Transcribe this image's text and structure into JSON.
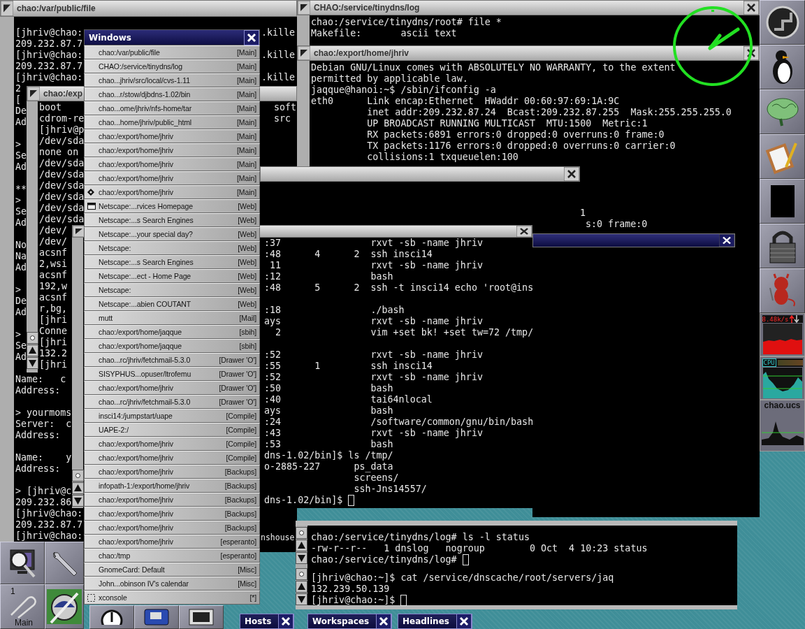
{
  "windows": [
    {
      "title": "chao:/var/public/file",
      "focused": false,
      "text_areas": [
        {
          "text": "[jhriv@chao:\n209.232.87.7\n[jhriv@chao:\n209.232.87.7\n[jhriv@chao:",
          "cursor": false
        },
        {
          "text": "2\n[\nDe\nAd\n\n>\nSe\nAd\n\n**\n>\nSe\nAd\n\nNo\nNa\nAd\n\n>\nDe\nAd\n\n>\nSe\nAd",
          "cursor": false
        },
        {
          "text": "Name:   c\nAddress:\n\n> yourmoms\nServer:  c\nAddress:\n\nName:    y\nAddress:\n\n> [jhriv@c\n209.232.86",
          "cursor": false
        },
        {
          "text": "[jhriv@chao:\n209.232.87.7\n[jhriv@chao:",
          "cursor": false
        },
        {
          "text": ".kille\n\n.kille\n\n.kille",
          "cursor": false
        }
      ]
    },
    {
      "title": "chao:/exp",
      "focused": false,
      "text_areas": [
        {
          "text": "boot\ncdrom-re\n[jhriv@p\n/dev/sda\nnone on\n/dev/sda\n/dev/sda\n/dev/sda\n/dev/sda\n/dev/sda\n/dev/sda",
          "cursor": false
        },
        {
          "text": "/dev/\n/dev/\nacsnf\n2,wsi\nacsnf\n192,w\nacsnf\nr,bg,\n[jhri\nConne\n[jhri\n132.2\n[jhri",
          "cursor": false
        },
        {
          "text": "soft\nsrc",
          "cursor": false
        }
      ]
    },
    {
      "title": "CHAO:/service/tinydns/log",
      "focused": false,
      "text_areas": [
        {
          "text": "chao:/service/tinydns/root# file *\nMakefile:       ascii text",
          "cursor": false
        }
      ]
    },
    {
      "title": "chao:/export/home/jhriv",
      "focused": false,
      "text_areas": [
        {
          "text": "Debian GNU/Linux comes with ABSOLUTELY NO WARRANTY, to the extent\npermitted by applicable law.\njaqque@hanoi:~$ /sbin/ifconfig -a\neth0      Link encap:Ethernet  HWaddr 00:60:97:69:1A:9C\n          inet addr:209.232.87.24  Bcast:209.232.87.255  Mask:255.255.255.0\n          UP BROADCAST RUNNING MULTICAST  MTU:1500  Metric:1\n          RX packets:6891 errors:0 dropped:0 overruns:0 frame:0\n          TX packets:1176 errors:0 dropped:0 overruns:0 carrier:0\n          collisions:1 txqueuelen:100",
          "cursor": false
        },
        {
          "text": "1\n s:0 frame:0",
          "cursor": false
        }
      ]
    },
    {
      "focused": false
    },
    {
      "focused": false,
      "text_areas": [
        {
          "text": ":37                rxvt -sb -name jhriv\n:48      4      2  ssh insci14\n 11                rxvt -sb -name jhriv\n:12                bash\n:48      5      2  ssh -t insci14 echo 'root@ins\n\n:18                ./bash\nays                rxvt -sb -name jhriv\n  2                vim +set bk! +set tw=72 /tmp/\n\n:52                rxvt -sb -name jhriv\n:55      1         ssh insci14\n:52                rxvt -sb -name jhriv\n:50                bash\n:40                tai64nlocal\nays                bash\n:24                /software/common/gnu/bin/bash\n:43                rxvt -sb -name jhriv\n:53                bash\ndns-1.02/bin]$ ls /tmp/\no-2885-227      ps_data\n                screens/\n                ssh-Jns14557/\ndns-1.02/bin]$ ",
          "cursor": true
        }
      ]
    },
    {
      "focused": true
    },
    {
      "text_areas": [
        {
          "text": "nshouse",
          "cursor": false
        }
      ]
    },
    {
      "text_areas": [
        {
          "text": "chao:/service/tinydns/log# ls -l status\n-rw-r--r--   1 dnslog   nogroup        0 Oct  4 10:23 status\nchao:/service/tinydns/log# ",
          "cursor": true
        }
      ]
    },
    {
      "text_areas": [
        {
          "text": "[jhriv@chao:~]$ cat /service/dnscache/root/servers/jaq\n132.239.50.139\n[jhriv@chao:~]$ ",
          "cursor": true
        }
      ]
    }
  ],
  "window_list_menu": {
    "title": "Windows",
    "items": [
      {
        "label": "chao:/var/public/file",
        "workspace": "[Main]",
        "kind": "normal"
      },
      {
        "label": "CHAO:/service/tinydns/log",
        "workspace": "[Main]",
        "kind": "normal"
      },
      {
        "label": "chao...jhriv/src/local/cvs-1.11",
        "workspace": "[Main]",
        "kind": "normal"
      },
      {
        "label": "chao...r/stow/djbdns-1.02/bin",
        "workspace": "[Main]",
        "kind": "normal"
      },
      {
        "label": "chao...ome/jhriv/nfs-home/tar",
        "workspace": "[Main]",
        "kind": "normal"
      },
      {
        "label": "chao...home/jhriv/public_html",
        "workspace": "[Main]",
        "kind": "normal"
      },
      {
        "label": "chao:/export/home/jhriv",
        "workspace": "[Main]",
        "kind": "normal"
      },
      {
        "label": "chao:/export/home/jhriv",
        "workspace": "[Main]",
        "kind": "normal"
      },
      {
        "label": "chao:/export/home/jhriv",
        "workspace": "[Main]",
        "kind": "normal"
      },
      {
        "label": "chao:/export/home/jhriv",
        "workspace": "[Main]",
        "kind": "normal"
      },
      {
        "label": "chao:/export/home/jhriv",
        "workspace": "[Main]",
        "kind": "current"
      },
      {
        "label": "Netscape:...rvices Homepage",
        "workspace": "[Web]",
        "kind": "iconified"
      },
      {
        "label": "Netscape:...s Search Engines",
        "workspace": "[Web]",
        "kind": "normal"
      },
      {
        "label": "Netscape:...your special day?",
        "workspace": "[Web]",
        "kind": "normal"
      },
      {
        "label": "Netscape:",
        "workspace": "[Web]",
        "kind": "normal"
      },
      {
        "label": "Netscape:...s Search Engines",
        "workspace": "[Web]",
        "kind": "normal"
      },
      {
        "label": "Netscape:...ect - Home Page",
        "workspace": "[Web]",
        "kind": "normal"
      },
      {
        "label": "Netscape:",
        "workspace": "[Web]",
        "kind": "normal"
      },
      {
        "label": "Netscape:...abien COUTANT",
        "workspace": "[Web]",
        "kind": "normal"
      },
      {
        "label": "mutt",
        "workspace": "[Mail]",
        "kind": "normal"
      },
      {
        "label": "chao:/export/home/jaqque",
        "workspace": "[sbih]",
        "kind": "normal"
      },
      {
        "label": "chao:/export/home/jaqque",
        "workspace": "[sbih]",
        "kind": "normal"
      },
      {
        "label": "chao...rc/jhriv/fetchmail-5.3.0",
        "workspace": "[Drawer 'O']",
        "kind": "normal"
      },
      {
        "label": "SISYPHUS...opuser/ltrofemu",
        "workspace": "[Drawer 'O']",
        "kind": "normal"
      },
      {
        "label": "chao:/export/home/jhriv",
        "workspace": "[Drawer 'O']",
        "kind": "normal"
      },
      {
        "label": "chao...rc/jhriv/fetchmail-5.3.0",
        "workspace": "[Drawer 'O']",
        "kind": "normal"
      },
      {
        "label": "insci14:/jumpstart/uape",
        "workspace": "[Compile]",
        "kind": "normal"
      },
      {
        "label": "UAPE-2:/",
        "workspace": "[Compile]",
        "kind": "normal"
      },
      {
        "label": "chao:/export/home/jhriv",
        "workspace": "[Compile]",
        "kind": "normal"
      },
      {
        "label": "chao:/export/home/jhriv",
        "workspace": "[Compile]",
        "kind": "normal"
      },
      {
        "label": "chao:/export/home/jhriv",
        "workspace": "[Backups]",
        "kind": "normal"
      },
      {
        "label": "infopath-1:/export/home/jhriv",
        "workspace": "[Backups]",
        "kind": "normal"
      },
      {
        "label": "chao:/export/home/jhriv",
        "workspace": "[Backups]",
        "kind": "normal"
      },
      {
        "label": "chao:/export/home/jhriv",
        "workspace": "[Backups]",
        "kind": "normal"
      },
      {
        "label": "chao:/export/home/jhriv",
        "workspace": "[Backups]",
        "kind": "normal"
      },
      {
        "label": "chao:/export/home/jhriv",
        "workspace": "[esperanto]",
        "kind": "normal"
      },
      {
        "label": "chao:/tmp",
        "workspace": "[esperanto]",
        "kind": "normal"
      },
      {
        "label": "GnomeCard: Default",
        "workspace": "[Misc]",
        "kind": "normal"
      },
      {
        "label": "John...obinson IV's calendar",
        "workspace": "[Misc]",
        "kind": "normal"
      },
      {
        "label": "xconsole",
        "workspace": "[*]",
        "kind": "sticky"
      }
    ]
  },
  "left_dock": {
    "workspace_number": "1",
    "workspace_name": "Main"
  },
  "right_dock": {
    "net_rate": "8.48k/s",
    "cpu_label": "CPU",
    "host_label": "chao.ucs"
  },
  "task_buttons": [
    {
      "label": "Hosts"
    },
    {
      "label": "Workspaces"
    },
    {
      "label": "Headlines"
    }
  ]
}
